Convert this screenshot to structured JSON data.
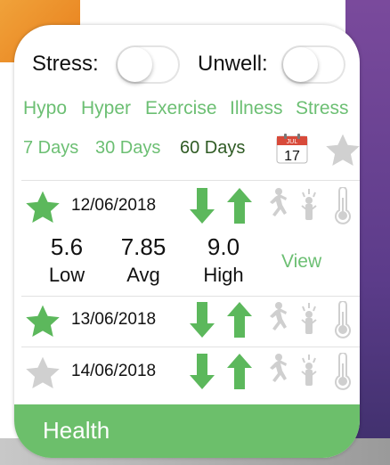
{
  "toggles": {
    "stress_label": "Stress:",
    "unwell_label": "Unwell:"
  },
  "tags": [
    "Hypo",
    "Hyper",
    "Exercise",
    "Illness",
    "Stress"
  ],
  "days": {
    "seven": "7 Days",
    "thirty": "30 Days",
    "sixty": "60 Days",
    "calendar_month": "JUL",
    "calendar_day": "17"
  },
  "entries": [
    {
      "date": "12/06/2018",
      "starred": true
    },
    {
      "date": "13/06/2018",
      "starred": true
    },
    {
      "date": "14/06/2018",
      "starred": false
    }
  ],
  "stats": {
    "low_value": "5.6",
    "low_label": "Low",
    "avg_value": "7.85",
    "avg_label": "Avg",
    "high_value": "9.0",
    "high_label": "High",
    "view_label": "View"
  },
  "footer": {
    "label": "Health"
  },
  "colors": {
    "accent": "#6cbf73",
    "active_text": "#2f5b24",
    "star_on": "#5cb85c",
    "star_off": "#d0d0d0",
    "icon_gray": "#cfcfcf"
  },
  "icons": [
    "calendar-icon",
    "star-icon",
    "arrow-down-icon",
    "arrow-up-icon",
    "exercise-icon",
    "illness-icon",
    "thermometer-icon"
  ]
}
